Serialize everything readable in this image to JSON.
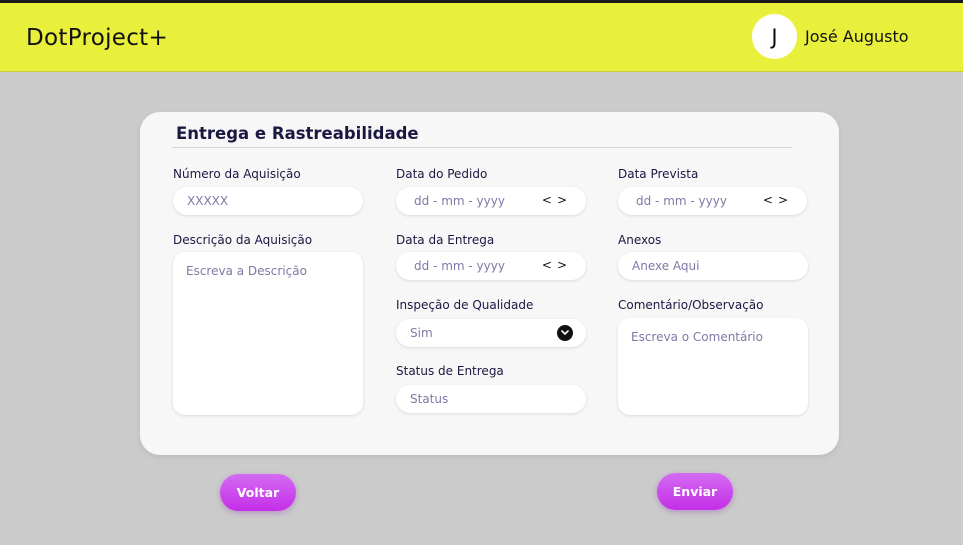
{
  "header": {
    "brand": "DotProject+",
    "avatar_initial": "J",
    "username": "José Augusto",
    "background": "#e9f03b"
  },
  "form": {
    "title": "Entrega e Rastreabilidade",
    "numero": {
      "label": "Número da Aquisição",
      "placeholder": "XXXXX"
    },
    "descricao": {
      "label": "Descrição da Aquisição",
      "placeholder": "Escreva a Descrição"
    },
    "data_pedido": {
      "label": "Data do Pedido",
      "placeholder": "dd - mm - yyyy",
      "prev": "<",
      "next": ">"
    },
    "data_entrega": {
      "label": "Data da Entrega",
      "placeholder": "dd - mm - yyyy",
      "prev": "<",
      "next": ">"
    },
    "inspecao": {
      "label": "Inspeção de Qualidade",
      "value": "Sim"
    },
    "status": {
      "label": "Status de Entrega",
      "placeholder": "Status"
    },
    "data_prevista": {
      "label": "Data Prevista",
      "placeholder": "dd - mm - yyyy",
      "prev": "<",
      "next": ">"
    },
    "anexos": {
      "label": "Anexos",
      "placeholder": "Anexe Aqui"
    },
    "comentario": {
      "label": "Comentário/Observação",
      "placeholder": "Escreva o Comentário"
    }
  },
  "actions": {
    "back_label": "Voltar",
    "submit_label": "Enviar",
    "accent": "#cd45ef"
  }
}
